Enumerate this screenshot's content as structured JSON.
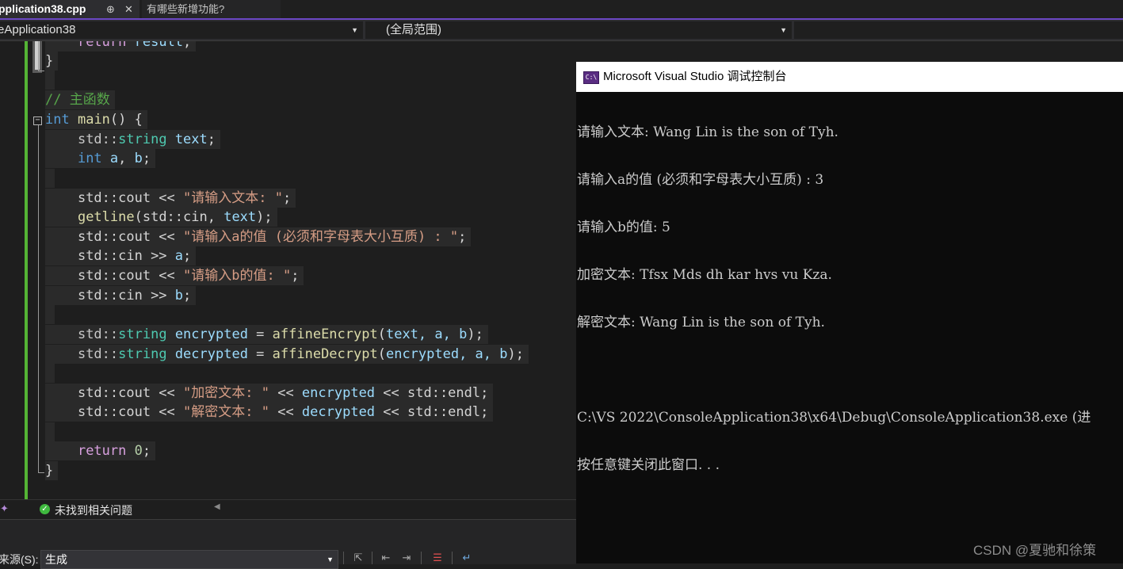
{
  "tabs": {
    "active_file": "pplication38.cpp",
    "pin_glyph": "⊕",
    "close_glyph": "✕",
    "preview_tab": "有哪些新增功能?"
  },
  "navbar": {
    "project": "eApplication38",
    "scope": "(全局范围)"
  },
  "code": {
    "l1_return": "return",
    "l1_result": "result",
    "l1_semi": ";",
    "l2_brace": "}",
    "l4_comment": "// 主函数",
    "l5_int": "int",
    "l5_main": "main",
    "l5_rest": "() {",
    "l6_ns": "std::",
    "l6_type": "string",
    "l6_var": "text",
    "l6_semi": ";",
    "l7_int": "int",
    "l7_a": "a",
    "l7_comma": ", ",
    "l7_b": "b",
    "l7_semi": ";",
    "cout_prefix": "std::cout << ",
    "cin_prefix": "std::cin >> ",
    "l9_str": "\"请输入文本: \"",
    "l10_fn": "getline",
    "l10_open": "(std::cin, ",
    "l10_var": "text",
    "l10_close": ");",
    "l11_str": "\"请输入a的值 (必须和字母表大小互质) : \"",
    "l12_var": "a",
    "l13_str": "\"请输入b的值: \"",
    "l14_var": "b",
    "l16_var": "encrypted",
    "l16_fn": "affineEncrypt",
    "l16_args": "text, a, b",
    "l17_var": "decrypted",
    "l17_fn": "affineDecrypt",
    "l17_args": "encrypted, a, b",
    "l19_str": "\"加密文本: \"",
    "l19_var": "encrypted",
    "l20_str": "\"解密文本: \"",
    "l20_var": "decrypted",
    "op_shift": " << ",
    "endl": "std::endl",
    "semi": ";",
    "eq": " = ",
    "paren_open": "(",
    "paren_close": ");",
    "l22_return": "return",
    "l22_zero": "0",
    "l23_brace": "}"
  },
  "status": {
    "no_issues": "未找到相关问题"
  },
  "output": {
    "source_label": "来源(S):",
    "source_value": "生成"
  },
  "console": {
    "title": "Microsoft Visual Studio 调试控制台",
    "icon_text": "C:\\",
    "lines": [
      "请输入文本: Wang Lin is the son of Tyh.",
      "请输入a的值 (必须和字母表大小互质) : 3",
      "请输入b的值: 5",
      "加密文本: Tfsx Mds dh kar hvs vu Kza.",
      "解密文本: Wang Lin is the son of Tyh.",
      "",
      "C:\\VS 2022\\ConsoleApplication38\\x64\\Debug\\ConsoleApplication38.exe (进",
      "按任意键关闭此窗口. . ."
    ]
  },
  "watermark": "CSDN @夏驰和徐策",
  "colors": {
    "keyword": "#569cd6",
    "type": "#4ec9b0",
    "variable": "#9cdcfe",
    "function": "#dcdcaa",
    "string": "#d69d85",
    "comment": "#57a64a",
    "number": "#b5cea8",
    "control": "#d8a0df",
    "accent": "#6b47c4",
    "change_bar": "#54b435"
  }
}
